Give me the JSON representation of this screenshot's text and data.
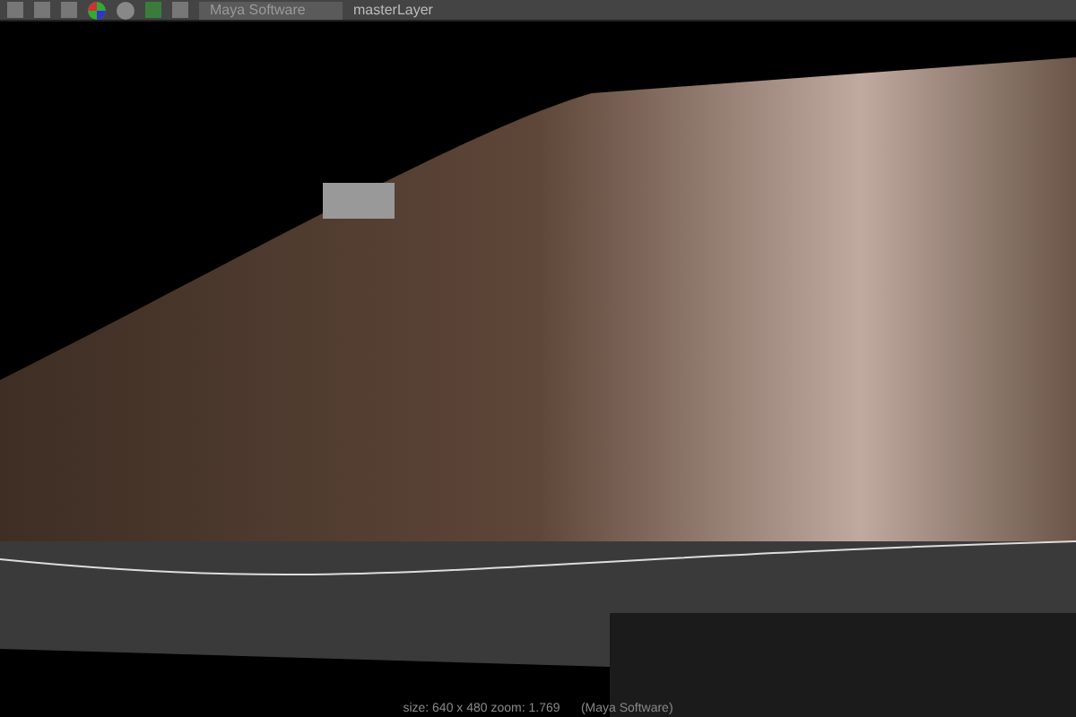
{
  "toolbar": {
    "renderer": "Maya Software",
    "layer": "masterLayer"
  },
  "render_view": {
    "image_info": "size: 640 x 480 zoom: 1.769",
    "renderer_info": "(Maya Software)"
  }
}
